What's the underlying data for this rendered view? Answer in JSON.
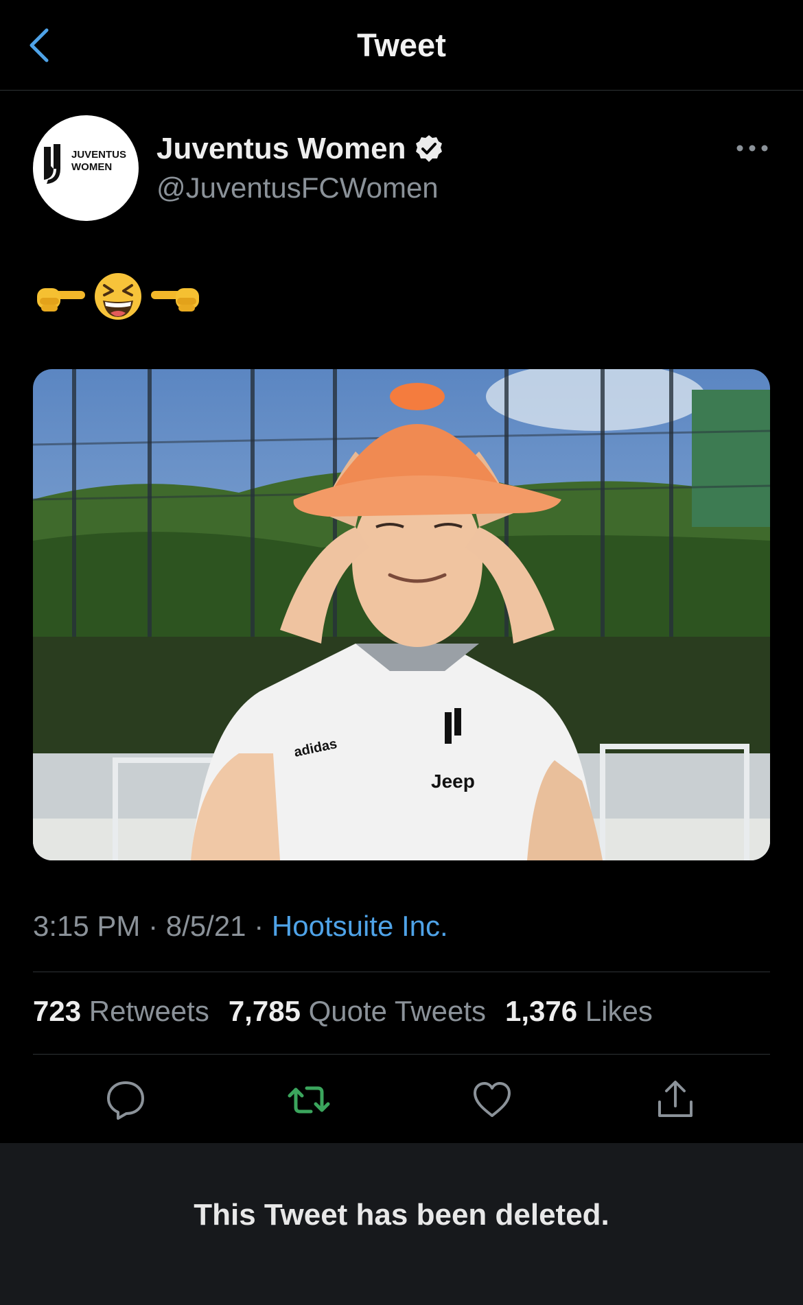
{
  "nav": {
    "back_icon": "chevron-left-icon",
    "title": "Tweet"
  },
  "author": {
    "avatar_text_line1": "JUVENTUS",
    "avatar_text_line2": "WOMEN",
    "display_name": "Juventus Women",
    "handle": "@JuventusFCWomen",
    "verified": true,
    "more_icon": "more-horizontal-icon"
  },
  "tweet": {
    "emojis": [
      "pointing-right-icon",
      "grinning-squinting-face-icon",
      "pointing-left-icon"
    ],
    "media_description": "photo",
    "media_text": {
      "shirt_brand": "adidas",
      "shirt_sponsor": "Jeep"
    },
    "time": "3:15 PM",
    "date": "8/5/21",
    "separator": "·",
    "source": "Hootsuite Inc."
  },
  "stats": {
    "retweets_count": "723",
    "retweets_label": "Retweets",
    "quotes_count": "7,785",
    "quotes_label": "Quote Tweets",
    "likes_count": "1,376",
    "likes_label": "Likes"
  },
  "actions": {
    "reply_icon": "reply-icon",
    "retweet_icon": "retweet-icon",
    "like_icon": "heart-icon",
    "share_icon": "share-icon",
    "retweet_color": "#3ba55d",
    "accent_color": "#4fa3e8"
  },
  "banner": {
    "text": "This Tweet has been deleted."
  }
}
